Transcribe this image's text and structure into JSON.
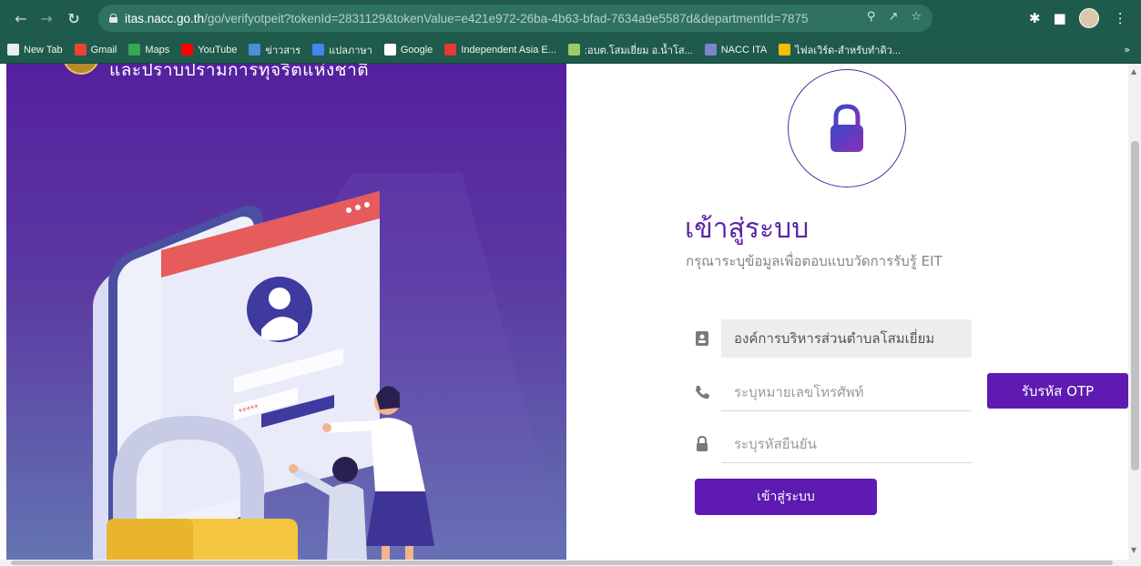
{
  "browser": {
    "url_host": "itas.nacc.go.th",
    "url_path": "/go/verifyotpeit?tokenId=2831129&tokenValue=e421e972-26ba-4b63-bfad-7634a9e5587d&departmentId=7875",
    "bookmarks": [
      {
        "label": "New Tab",
        "icon_color": "#e8f0ee"
      },
      {
        "label": "Gmail",
        "icon_color": "#ea4335"
      },
      {
        "label": "Maps",
        "icon_color": "#34a853"
      },
      {
        "label": "YouTube",
        "icon_color": "#ff0000"
      },
      {
        "label": "ข่าวสาร",
        "icon_color": "#4a90d9"
      },
      {
        "label": "แปลภาษา",
        "icon_color": "#4285f4"
      },
      {
        "label": "Google",
        "icon_color": "#ffffff"
      },
      {
        "label": "Independent Asia E...",
        "icon_color": "#e53935"
      },
      {
        "label": ":อบต.โสมเยี่ยม อ.น้ำโส...",
        "icon_color": "#9ccc65"
      },
      {
        "label": "NACC ITA",
        "icon_color": "#7986cb"
      },
      {
        "label": "ไฟลเวิร์ด-สำหรับทำดิว...",
        "icon_color": "#fbbc04"
      }
    ],
    "more_label": "»"
  },
  "left": {
    "org_text": "และปราบปรามการทุจริตแห่งชาติ"
  },
  "login": {
    "title": "เข้าสู่ระบบ",
    "subtitle": "กรุณาระบุข้อมูลเพื่อตอบแบบวัดการรับรู้ EIT",
    "org_value": "องค์การบริหารส่วนตำบลโสมเยี่ยม",
    "phone_placeholder": "ระบุหมายเลขโทรศัพท์",
    "otp_placeholder": "ระบุรหัสยืนยัน",
    "otp_button": "รับรหัส OTP",
    "submit_button": "เข้าสู่ระบบ"
  },
  "colors": {
    "brand": "#5f1ab1",
    "title": "#5f23a6",
    "chrome": "#1f5b4c"
  }
}
